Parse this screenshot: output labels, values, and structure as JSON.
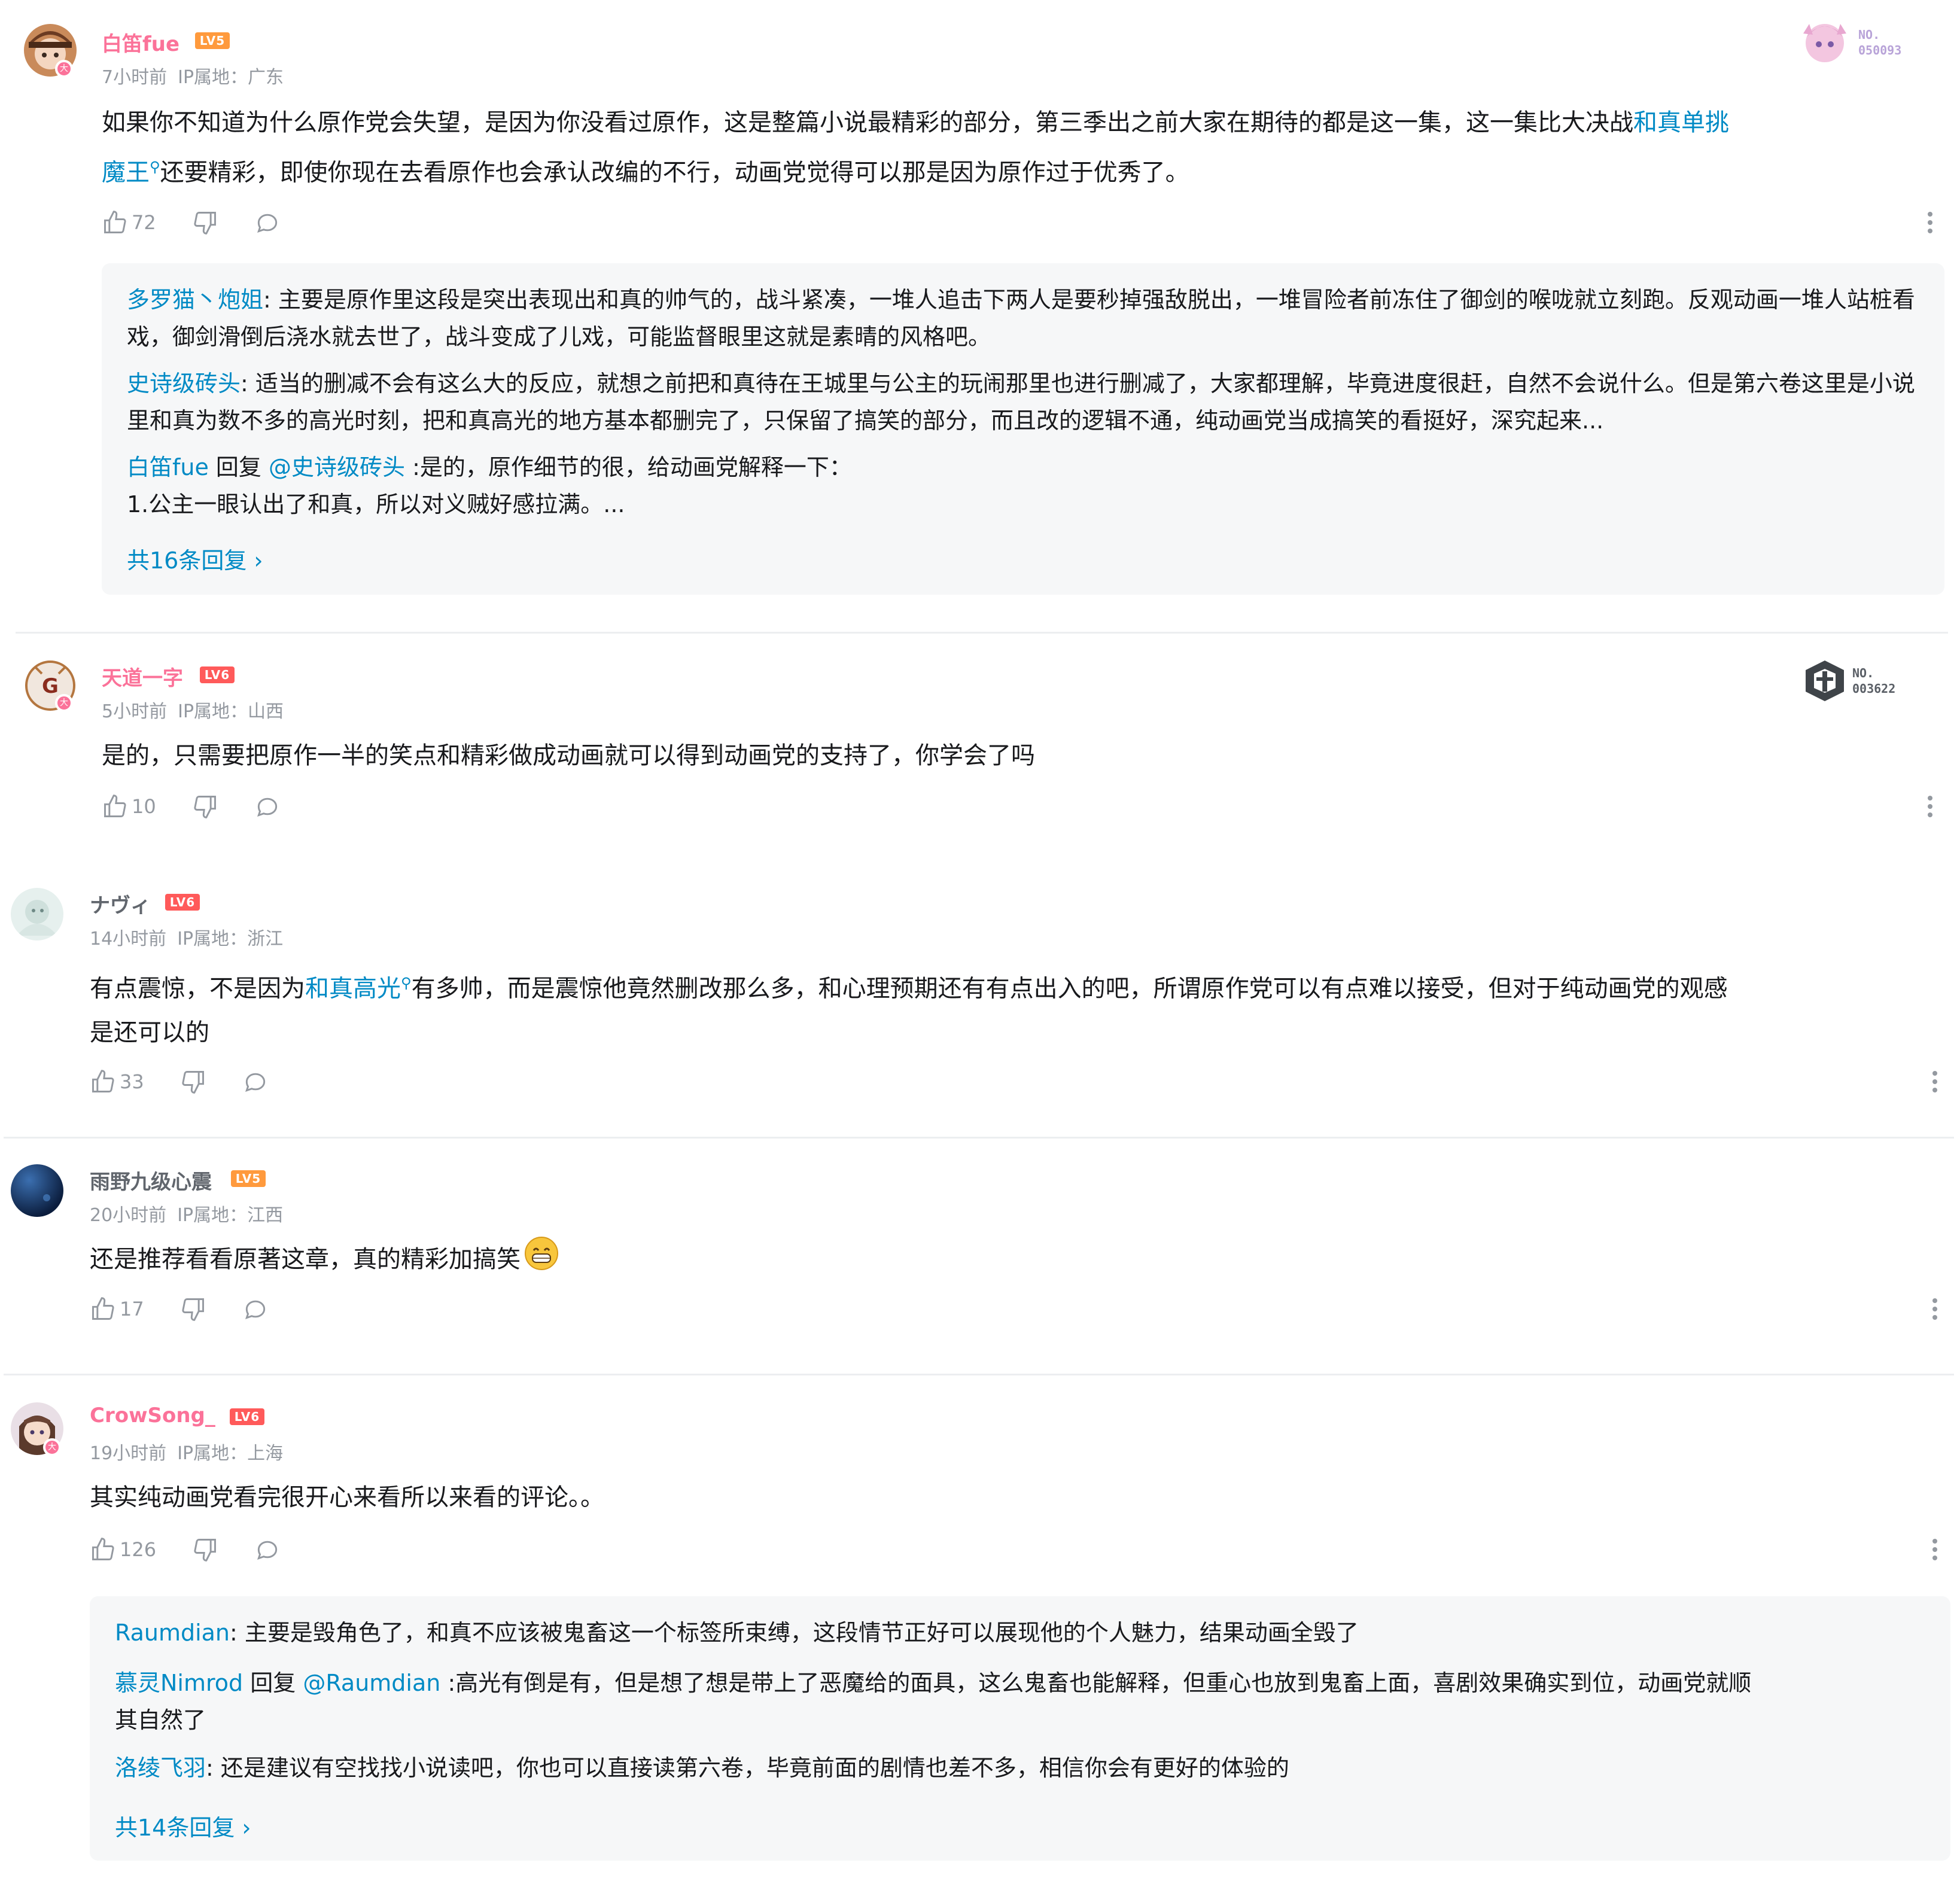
{
  "comments": [
    {
      "username": "白笛fue",
      "level": "LV5",
      "time": "7小时前",
      "ip": "IP属地：广东",
      "text_1": "如果你不知道为什么原作党会失望，是因为你没看过原作，这是整篇小说最精彩的部分，第三季出之前大家在期待的都是这一集，这一集比大决战",
      "link": "和真单挑",
      "link2": "魔王",
      "text_2": "还要精彩，即使你现在去看原作也会承认改编的不行，动画党觉得可以那是因为原作过于优秀了。",
      "likes": "72",
      "badge_no": "NO.",
      "badge_num": "050093",
      "replies": [
        {
          "name": "多罗猫丶炮姐",
          "text": ": 主要是原作里这段是突出表现出和真的帅气的，战斗紧凑，一堆人追击下两人是要秒掉强敌脱出，一堆冒险者前冻住了御剑的喉咙就立刻跑。反观动画一堆人站桩看戏，御剑滑倒后浇水就去世了，战斗变成了儿戏，可能监督眼里这就是素晴的风格吧。"
        },
        {
          "name": "史诗级砖头",
          "text": ": 适当的删减不会有这么大的反应，就想之前把和真待在王城里与公主的玩闹那里也进行删减了，大家都理解，毕竟进度很赶，自然不会说什么。但是第六卷这里是小说里和真为数不多的高光时刻，把和真高光的地方基本都删完了，只保留了搞笑的部分，而且改的逻辑不通，纯动画党当成搞笑的看挺好，深究起来..."
        },
        {
          "name": "白笛fue",
          "reply_word": " 回复 ",
          "target": "@史诗级砖头",
          "text": " :是的，原作细节的很，给动画党解释一下：",
          "text_line2": "1.公主一眼认出了和真，所以对义贼好感拉满。..."
        }
      ],
      "reply_more": "共16条回复 ›"
    },
    {
      "username": "天道一字",
      "level": "LV6",
      "time": "5小时前",
      "ip": "IP属地：山西",
      "text": "是的，只需要把原作一半的笑点和精彩做成动画就可以得到动画党的支持了，你学会了吗",
      "likes": "10",
      "badge_no": "NO.",
      "badge_num": "003622"
    },
    {
      "username": "ナヴィ",
      "level": "LV6",
      "time": "14小时前",
      "ip": "IP属地：浙江",
      "text_1": "有点震惊，不是因为",
      "link": "和真高光",
      "text_2": "有多帅，而是震惊他竟然删改那么多，和心理预期还有有点出入的吧，所谓原作党可以有点难以接受，但对于纯动画党的观感",
      "text_3": "是还可以的",
      "likes": "33"
    },
    {
      "username": "雨野九级心震",
      "level": "LV5",
      "time": "20小时前",
      "ip": "IP属地：江西",
      "text": "还是推荐看看原著这章，真的精彩加搞笑",
      "likes": "17"
    },
    {
      "username": "CrowSong_",
      "level": "LV6",
      "time": "19小时前",
      "ip": "IP属地：上海",
      "text": "其实纯动画党看完很开心来看所以来看的评论。。",
      "likes": "126",
      "replies": [
        {
          "name": "Raumdian",
          "text": ": 主要是毁角色了，和真不应该被鬼畜这一个标签所束缚，这段情节正好可以展现他的个人魅力，结果动画全毁了"
        },
        {
          "name": "慕灵Nimrod",
          "reply_word": " 回复 ",
          "target": "@Raumdian",
          "text": " :高光有倒是有，但是想了想是带上了恶魔给的面具，这么鬼畜也能解释，但重心也放到鬼畜上面，喜剧效果确实到位，动画党就顺",
          "text_line2": "其自然了"
        },
        {
          "name": "洛绫飞羽",
          "text": ": 还是建议有空找找小说读吧，你也可以直接读第六卷，毕竟前面的剧情也差不多，相信你会有更好的体验的"
        }
      ],
      "reply_more": "共14条回复 ›"
    }
  ],
  "colors": {
    "vip_name": "#fb7299",
    "link": "#008ac5",
    "meta": "#9499a0",
    "lv5": "#ff9a3d",
    "lv6": "#ff5a5a"
  }
}
